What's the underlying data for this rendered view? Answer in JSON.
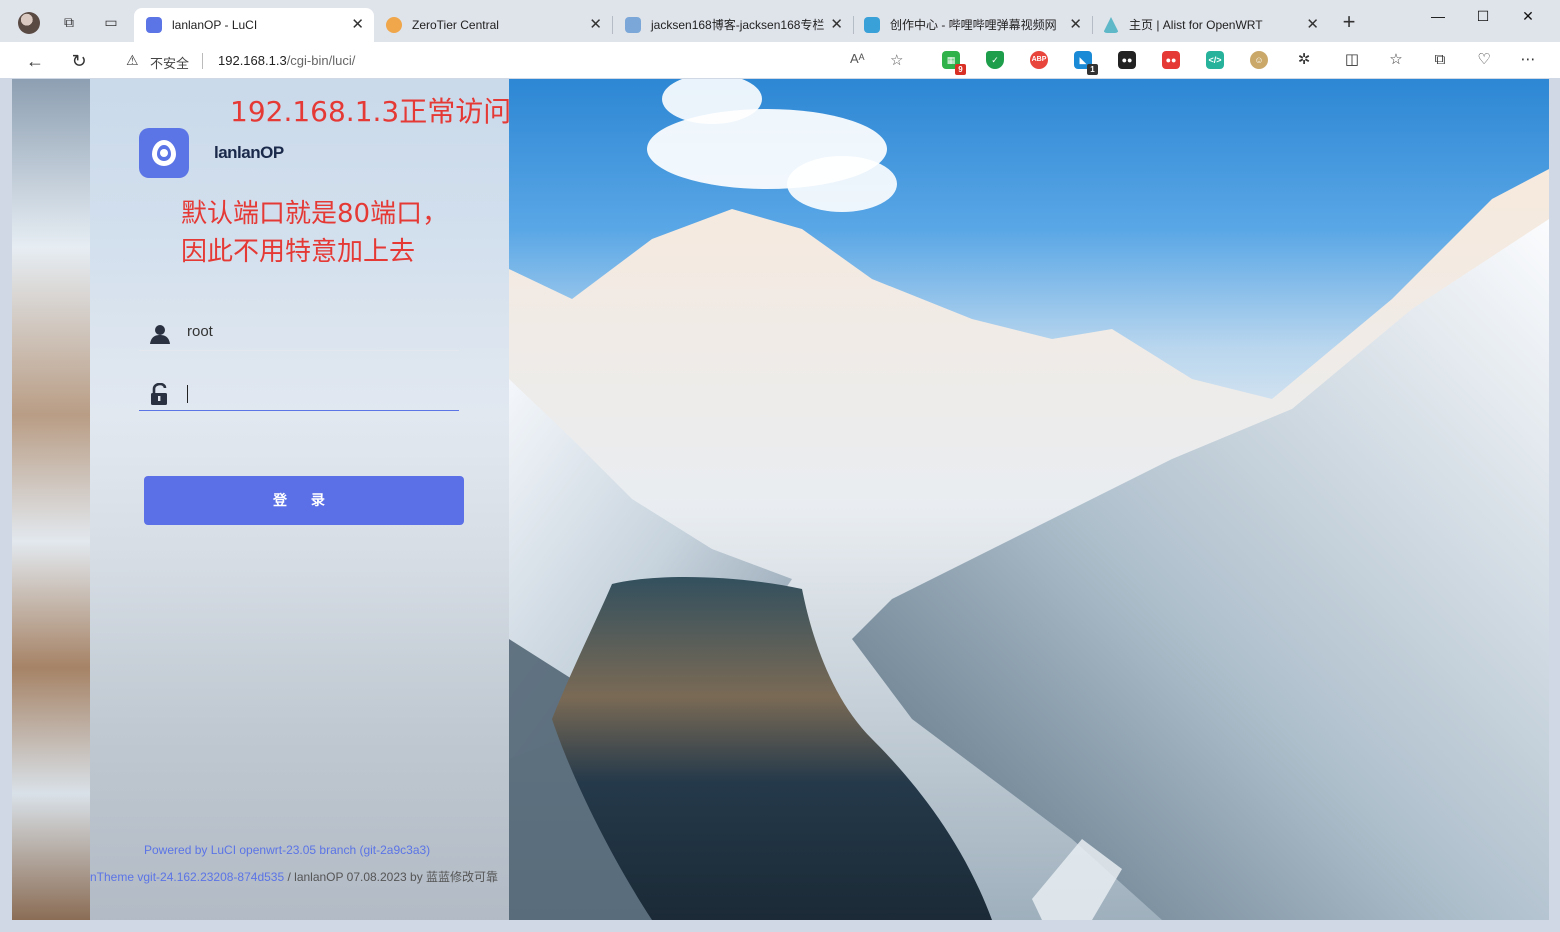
{
  "browser": {
    "tabs": [
      {
        "title": "lanlanOP - LuCI",
        "active": true,
        "favicon_color": "#5b74e6"
      },
      {
        "title": "ZeroTier Central",
        "active": false,
        "favicon_color": "#f0a64a"
      },
      {
        "title": "jacksen168博客-jacksen168专栏",
        "active": false,
        "favicon_color": "#7aa7d8"
      },
      {
        "title": "创作中心 - 哔哩哔哩弹幕视频网",
        "active": false,
        "favicon_color": "#3aa0d8"
      },
      {
        "title": "主页 | Alist for OpenWRT",
        "active": false,
        "favicon_color": "#5fb8c8"
      }
    ],
    "security_label": "不安全",
    "url_host": "192.168.1.3",
    "url_path": "/cgi-bin/luci/",
    "read_aloud_icon": "Aᴬ",
    "extension_badges": {
      "first": "9",
      "fourth": "1"
    }
  },
  "page": {
    "annotation_top": "192.168.1.3正常访问",
    "annotation_line1": "默认端口就是80端口，",
    "annotation_line2": "因此不用特意加上去",
    "brand": "lanlanOP",
    "username_value": "root",
    "password_value": "",
    "login_button": "登 录",
    "footer_line1": "Powered by LuCI openwrt-23.05 branch (git-2a9c3a3)",
    "footer_line2_link": "nTheme vgit-24.162.23208-874d535",
    "footer_line2_rest": " / lanlanOP 07.08.2023 by 蓝蓝修改可靠"
  },
  "colors": {
    "accent": "#5b74e6",
    "annotation": "#e53935"
  }
}
